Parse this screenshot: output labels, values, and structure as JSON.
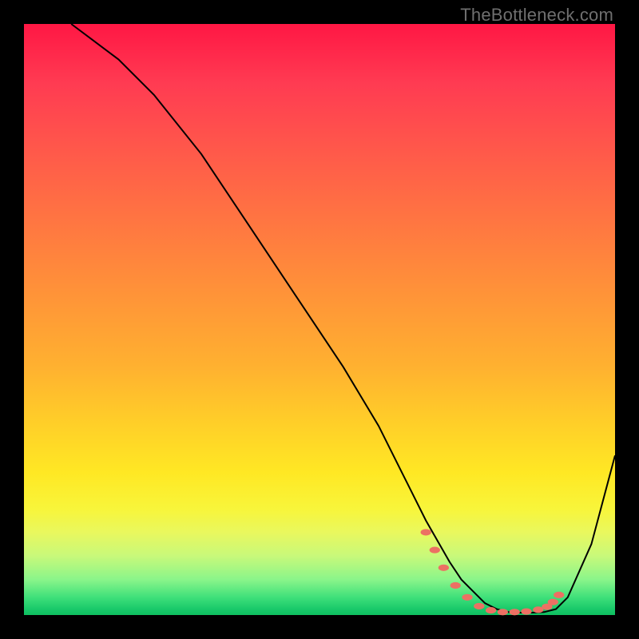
{
  "watermark": "TheBottleneck.com",
  "chart_data": {
    "type": "line",
    "title": "",
    "xlabel": "",
    "ylabel": "",
    "xlim": [
      0,
      100
    ],
    "ylim": [
      0,
      100
    ],
    "grid": false,
    "legend": false,
    "series": [
      {
        "name": "bottleneck-curve",
        "x": [
          8,
          12,
          16,
          22,
          30,
          38,
          46,
          54,
          60,
          64,
          68,
          72,
          74,
          76,
          78,
          80,
          82,
          84,
          86,
          88,
          90,
          92,
          96,
          100
        ],
        "y": [
          100,
          97,
          94,
          88,
          78,
          66,
          54,
          42,
          32,
          24,
          16,
          9,
          6,
          4,
          2,
          1,
          0.5,
          0.4,
          0.4,
          0.5,
          1,
          3,
          12,
          27
        ]
      }
    ],
    "markers": {
      "name": "highlight-dots",
      "color": "#ec7063",
      "x": [
        68,
        69.5,
        71,
        73,
        75,
        77,
        79,
        81,
        83,
        85,
        87,
        88.5,
        89.5,
        90.5
      ],
      "y": [
        14,
        11,
        8,
        5,
        3,
        1.5,
        0.8,
        0.5,
        0.5,
        0.6,
        0.9,
        1.4,
        2.2,
        3.4
      ]
    },
    "background_gradient": {
      "orientation": "vertical",
      "stops": [
        {
          "pos": 0.0,
          "color": "#ff1744"
        },
        {
          "pos": 0.5,
          "color": "#ff9b36"
        },
        {
          "pos": 0.78,
          "color": "#fce93a"
        },
        {
          "pos": 1.0,
          "color": "#12c263"
        }
      ]
    }
  }
}
